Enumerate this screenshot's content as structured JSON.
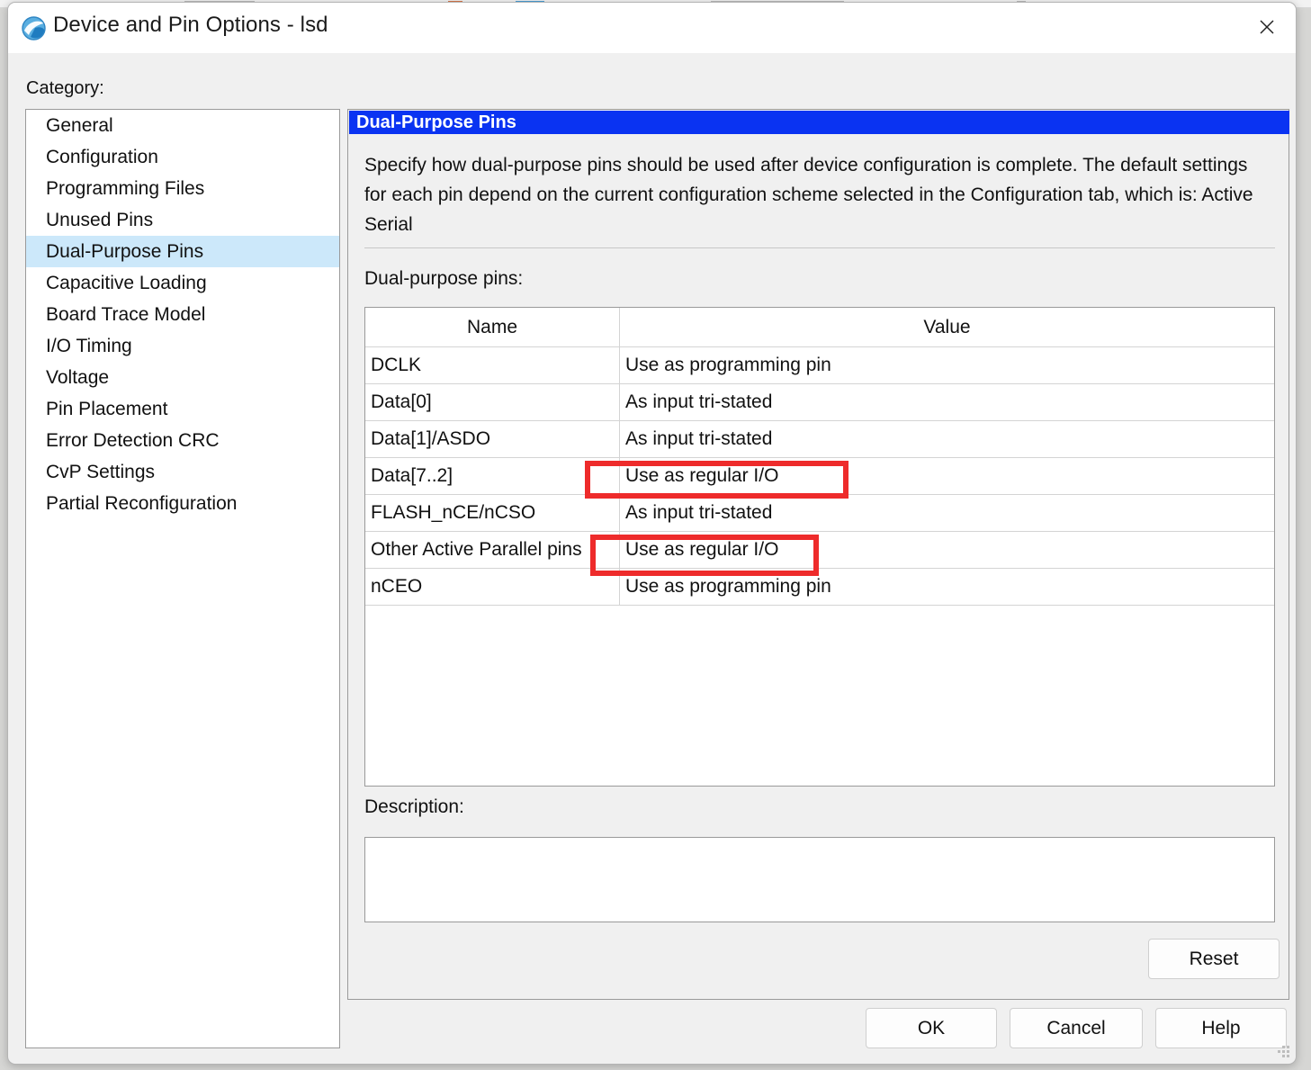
{
  "window": {
    "title": "Device and Pin Options - lsd",
    "icon": "quartus-globe-icon",
    "close_label": "✕"
  },
  "category": {
    "label": "Category:",
    "items": [
      {
        "label": "General",
        "selected": false
      },
      {
        "label": "Configuration",
        "selected": false
      },
      {
        "label": "Programming Files",
        "selected": false
      },
      {
        "label": "Unused Pins",
        "selected": false
      },
      {
        "label": "Dual-Purpose Pins",
        "selected": true
      },
      {
        "label": "Capacitive Loading",
        "selected": false
      },
      {
        "label": "Board Trace Model",
        "selected": false
      },
      {
        "label": "I/O Timing",
        "selected": false
      },
      {
        "label": "Voltage",
        "selected": false
      },
      {
        "label": "Pin Placement",
        "selected": false
      },
      {
        "label": "Error Detection CRC",
        "selected": false
      },
      {
        "label": "CvP Settings",
        "selected": false
      },
      {
        "label": "Partial Reconfiguration",
        "selected": false
      }
    ]
  },
  "panel": {
    "header": "Dual-Purpose Pins",
    "intro": "Specify how dual-purpose pins should be used after device configuration is complete. The default settings for each pin depend on the current configuration scheme selected in the Configuration tab, which is:  Active Serial",
    "table_label": "Dual-purpose pins:",
    "columns": [
      "Name",
      "Value"
    ],
    "rows": [
      {
        "name": "DCLK",
        "value": "Use as programming pin"
      },
      {
        "name": "Data[0]",
        "value": "As input tri-stated"
      },
      {
        "name": "Data[1]/ASDO",
        "value": "As input tri-stated"
      },
      {
        "name": "Data[7..2]",
        "value": "Use as regular I/O"
      },
      {
        "name": "FLASH_nCE/nCSO",
        "value": "As input tri-stated"
      },
      {
        "name": "Other Active Parallel pins",
        "value": "Use as regular I/O"
      },
      {
        "name": "nCEO",
        "value": "Use as programming pin"
      }
    ],
    "description_label": "Description:",
    "description_value": "",
    "reset_label": "Reset"
  },
  "footer": {
    "ok_label": "OK",
    "cancel_label": "Cancel",
    "help_label": "Help"
  },
  "annotations": {
    "highlight_color": "#ee2b2b",
    "boxes": [
      {
        "target": "Data[7..2] value",
        "text": "Use as regular I/O"
      },
      {
        "target": "Other Active Parallel pins value",
        "text": "Use as regular I/O"
      }
    ]
  },
  "colors": {
    "panel_header_bg": "#0a33f2",
    "selection_bg": "#cce8fa",
    "dialog_bg": "#f0f0f0"
  }
}
